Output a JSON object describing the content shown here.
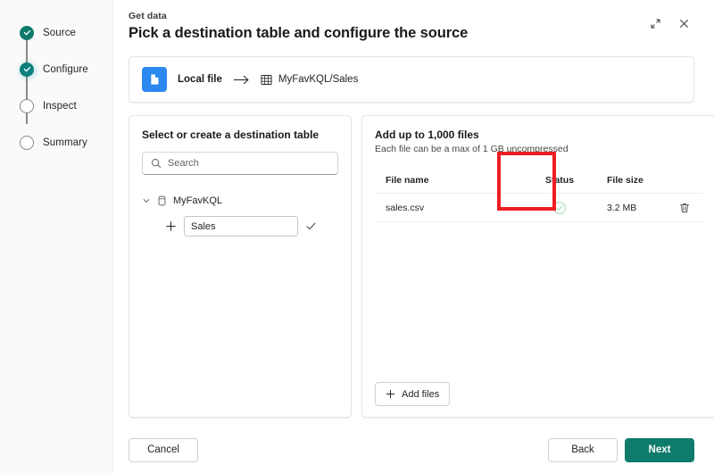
{
  "window": {
    "eyebrow": "Get data",
    "title": "Pick a destination table and configure the source",
    "expand_icon": "expand-icon",
    "close_icon": "close-icon"
  },
  "stepper": {
    "steps": [
      {
        "label": "Source",
        "state": "done"
      },
      {
        "label": "Configure",
        "state": "current"
      },
      {
        "label": "Inspect",
        "state": "todo"
      },
      {
        "label": "Summary",
        "state": "todo"
      }
    ]
  },
  "source_strip": {
    "icon": "file-document-icon",
    "source_label": "Local file",
    "arrow_icon": "arrow-right-icon",
    "destination_icon": "table-grid-icon",
    "destination_label": "MyFavKQL/Sales"
  },
  "destination_panel": {
    "heading": "Select or create a destination table",
    "search_placeholder": "Search",
    "search_value": "",
    "search_icon": "search-icon",
    "tree": {
      "chevron_icon": "chevron-down-icon",
      "database_icon": "database-icon",
      "database_name": "MyFavKQL",
      "new_table": {
        "plus_icon": "plus-icon",
        "value": "Sales",
        "confirm_icon": "checkmark-icon"
      }
    }
  },
  "files_panel": {
    "heading": "Add up to 1,000 files",
    "subheading": "Each file can be a max of 1 GB uncompressed",
    "columns": [
      "File name",
      "Status",
      "File size"
    ],
    "rows": [
      {
        "file_name": "sales.csv",
        "status_icon": "checkmark-circle-icon",
        "file_size": "3.2 MB",
        "delete_icon": "trash-icon"
      }
    ],
    "add_files_label": "Add files",
    "add_files_icon": "plus-icon"
  },
  "footer": {
    "cancel_label": "Cancel",
    "back_label": "Back",
    "next_label": "Next"
  },
  "annotation": {
    "target": "status-column",
    "color": "#EE1D23"
  },
  "colors": {
    "accent_green": "#0F7B6C",
    "file_blue": "#2B88F0",
    "status_green": "#8FD4A8",
    "annotation_red": "#EE1D23"
  }
}
